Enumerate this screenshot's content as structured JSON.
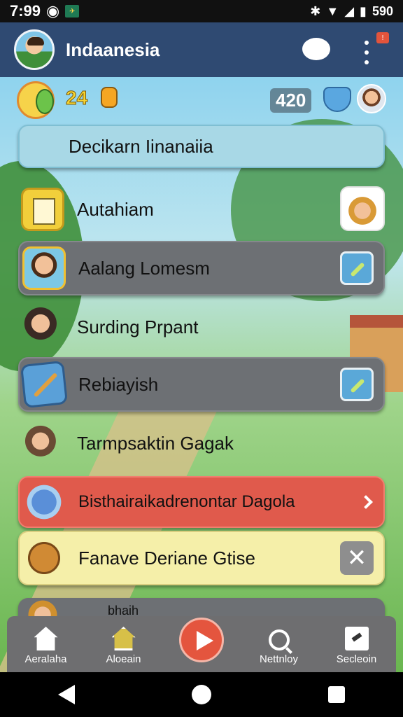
{
  "status_bar": {
    "time": "7:99",
    "battery": "590"
  },
  "header": {
    "title": "Indaanesia"
  },
  "hud": {
    "coins": "24",
    "score": "420"
  },
  "list": [
    {
      "label": "Decikarn Iinanaiia",
      "style": "blue"
    },
    {
      "label": "Autahiam",
      "style": "plain"
    },
    {
      "label": "Aalang Lomesm",
      "style": "grey"
    },
    {
      "label": "Surding Prpant",
      "style": "plain"
    },
    {
      "label": "Rebiayish",
      "style": "grey"
    },
    {
      "label": "Tarmpsaktin Gagak",
      "style": "plain"
    },
    {
      "label": "Bisthairaikadrenontar Dagola",
      "style": "red"
    },
    {
      "label": "Fanave Deriane Gtise",
      "style": "cream"
    },
    {
      "label": "bhaih",
      "style": "grey"
    }
  ],
  "bottom_nav": [
    {
      "label": "Aeralaha",
      "icon": "home-icon"
    },
    {
      "label": "Aloeain",
      "icon": "house-icon"
    },
    {
      "label": "",
      "icon": "play-icon"
    },
    {
      "label": "Nettnloy",
      "icon": "search-icon"
    },
    {
      "label": "Secleoin",
      "icon": "section-icon"
    }
  ],
  "colors": {
    "header_bg": "#2f4a72",
    "red_card": "#e05a4c",
    "cream_card": "#f5efa9",
    "grey_card": "#6d7074",
    "accent_blue": "#5aa8d8"
  }
}
